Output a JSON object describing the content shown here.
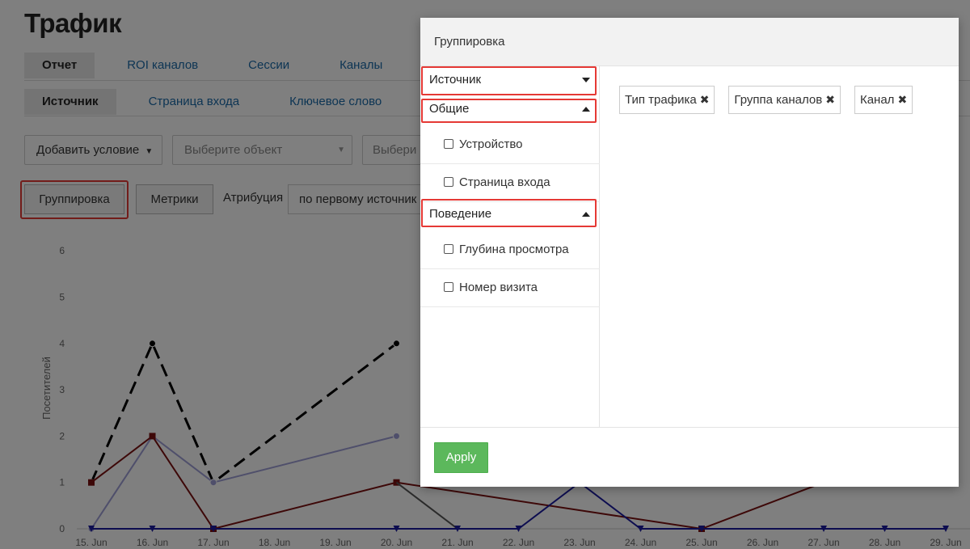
{
  "page": {
    "title": "Трафик",
    "tabs_primary": [
      {
        "label": "Отчет",
        "active": true
      },
      {
        "label": "ROI каналов",
        "active": false
      },
      {
        "label": "Сессии",
        "active": false
      },
      {
        "label": "Каналы",
        "active": false
      }
    ],
    "tabs_secondary": [
      {
        "label": "Источник",
        "active": true
      },
      {
        "label": "Страница входа",
        "active": false
      },
      {
        "label": "Ключевое слово",
        "active": false
      }
    ],
    "filters": {
      "add_condition": "Добавить условие",
      "select_object_placeholder": "Выберите объект",
      "select_second_placeholder": "Выбери"
    },
    "toolbar": {
      "grouping_label": "Группировка",
      "metrics_label": "Метрики",
      "attribution_label": "Атрибуция",
      "attribution_value": "по первому источник"
    }
  },
  "chart_data": {
    "type": "line",
    "ylabel": "Посетителей",
    "ylim": [
      0,
      6
    ],
    "yticks": [
      0,
      1,
      2,
      3,
      4,
      5,
      6
    ],
    "categories": [
      "15. Jun",
      "16. Jun",
      "17. Jun",
      "18. Jun",
      "19. Jun",
      "20. Jun",
      "21. Jun",
      "22. Jun",
      "23. Jun",
      "24. Jun",
      "25. Jun",
      "26. Jun",
      "27. Jun",
      "28. Jun",
      "29. Jun"
    ],
    "series": [
      {
        "color": "#000000",
        "style": "dashed",
        "marker": "circle",
        "values": [
          1,
          4,
          1,
          null,
          null,
          4,
          null,
          null,
          null,
          null,
          null,
          null,
          null,
          null,
          null
        ]
      },
      {
        "color": "#9f9fd6",
        "style": "solid",
        "marker": "circle",
        "values": [
          0,
          2,
          1,
          null,
          null,
          2,
          null,
          null,
          null,
          null,
          null,
          null,
          null,
          null,
          null
        ]
      },
      {
        "color": "#7a1010",
        "style": "solid",
        "marker": "square",
        "values": [
          1,
          2,
          0,
          null,
          null,
          1,
          null,
          null,
          null,
          null,
          0,
          null,
          1,
          null,
          null
        ]
      },
      {
        "color": "#555555",
        "style": "solid",
        "marker": "none",
        "values": [
          null,
          null,
          null,
          null,
          null,
          1,
          0,
          null,
          null,
          null,
          null,
          null,
          null,
          null,
          null
        ]
      },
      {
        "color": "#1a1aa0",
        "style": "solid",
        "marker": "triangle-down",
        "values": [
          0,
          0,
          0,
          null,
          null,
          0,
          0,
          0,
          1,
          0,
          0,
          null,
          0,
          0,
          0
        ]
      }
    ]
  },
  "modal": {
    "title": "Группировка",
    "groups": [
      {
        "label": "Источник",
        "expanded": false
      },
      {
        "label": "Общие",
        "expanded": true,
        "options": [
          "Устройство",
          "Страница входа"
        ]
      },
      {
        "label": "Поведение",
        "expanded": true,
        "options": [
          "Глубина просмотра",
          "Номер визита"
        ]
      }
    ],
    "selected": [
      "Тип трафика",
      "Группа каналов",
      "Канал"
    ],
    "apply_label": "Apply"
  },
  "colors": {
    "highlight": "#e53935",
    "apply": "#5cb85c",
    "link": "#1b6aa8"
  }
}
